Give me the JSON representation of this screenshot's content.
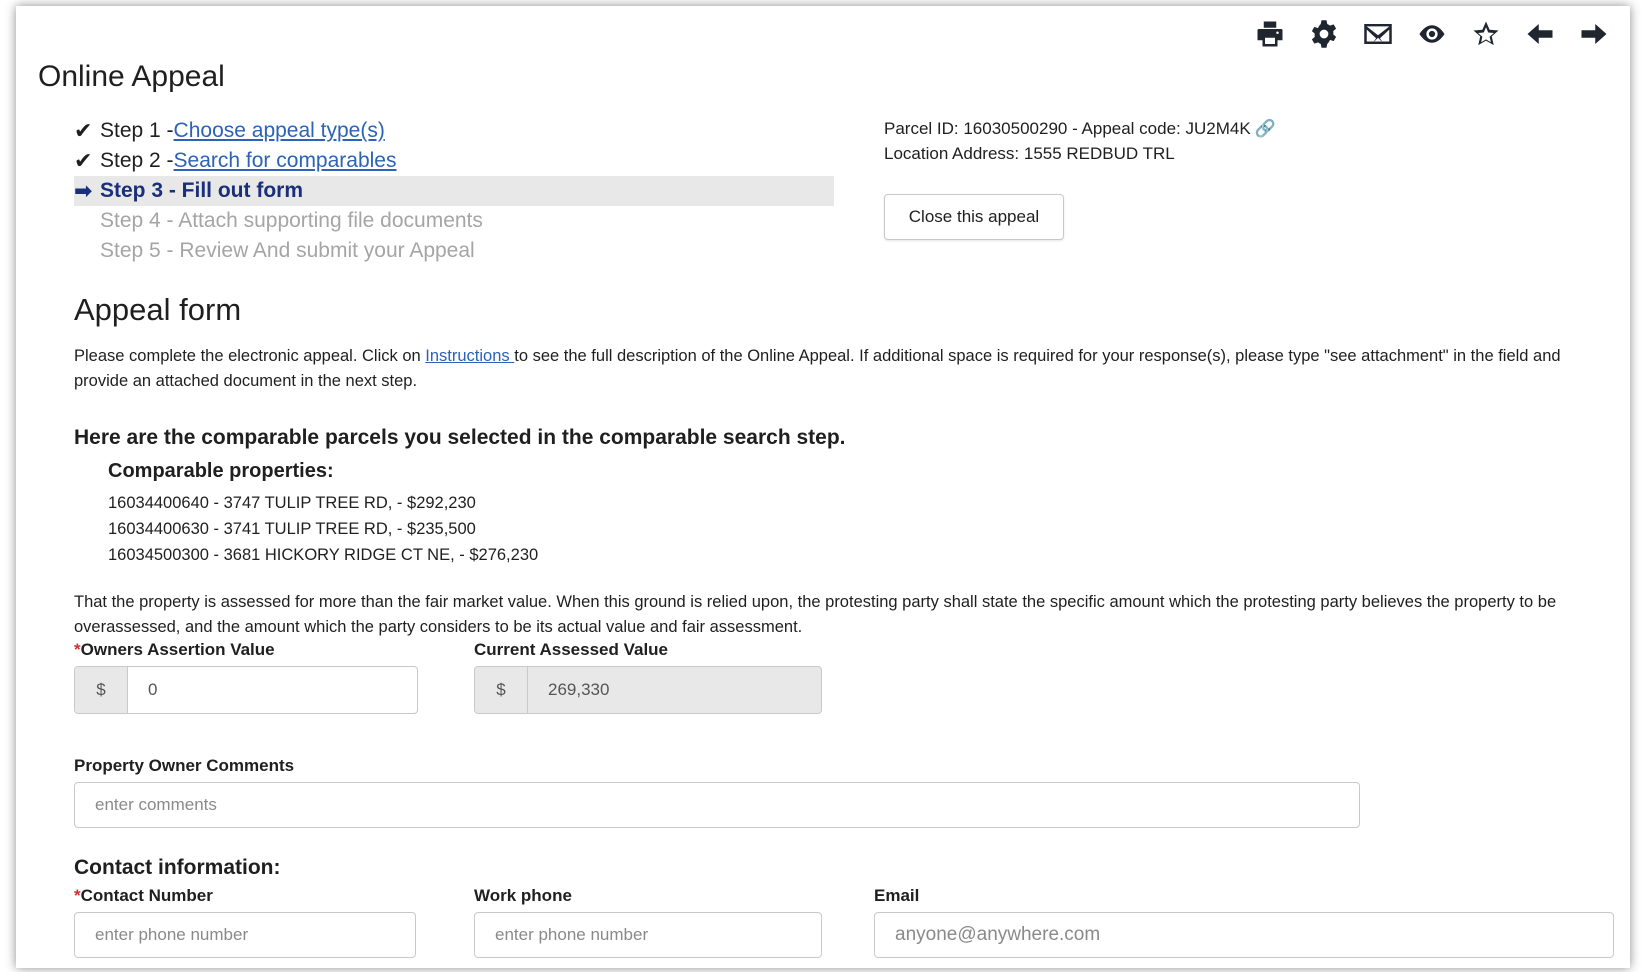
{
  "toolbar": {
    "icons": [
      "print-icon",
      "gear-icon",
      "mail-icon",
      "eye-icon",
      "star-icon",
      "arrow-left-icon",
      "arrow-right-icon"
    ]
  },
  "page": {
    "title": "Online Appeal"
  },
  "steps": [
    {
      "prefix": "Step 1 - ",
      "link": "Choose appeal type(s)",
      "status": "done"
    },
    {
      "prefix": "Step 2 - ",
      "link": "Search for comparables",
      "status": "done"
    },
    {
      "label": "Step 3 - Fill out form",
      "status": "current"
    },
    {
      "label": "Step 4 - Attach supporting file documents",
      "status": "pending"
    },
    {
      "label": "Step 5 - Review And submit your Appeal",
      "status": "pending"
    }
  ],
  "parcel": {
    "line1": "Parcel ID: 16030500290 - Appeal code: JU2M4K",
    "line2": "Location Address: 1555 REDBUD TRL",
    "close_button": "Close this appeal"
  },
  "form": {
    "title": "Appeal form",
    "instructions_before": "Please complete the electronic appeal. Click on ",
    "instructions_link": "Instructions ",
    "instructions_after": "to see the full description of the Online Appeal. If additional space is required for your response(s), please type \"see attachment\" in the field and provide an attached document in the next step.",
    "comparables_heading": "Here are the comparable parcels you selected in the comparable search step.",
    "comparables_subheading": "Comparable properties:",
    "comparables": [
      "16034400640 - 3747 TULIP TREE RD, - $292,230",
      "16034400630 - 3741 TULIP TREE RD, - $235,500",
      "16034500300 - 3681 HICKORY RIDGE CT NE, - $276,230"
    ],
    "ground_text": "That the property is assessed for more than the fair market value. When this ground is relied upon, the protesting party shall state the specific amount which the protesting party believes the property to be overassessed, and the amount which the party considers to be its actual value and fair assessment.",
    "owners_assertion": {
      "label": "Owners Assertion Value",
      "required_mark": "*",
      "currency": "$",
      "value": "0"
    },
    "current_assessed": {
      "label": "Current Assessed Value",
      "currency": "$",
      "value": "269,330"
    },
    "comments": {
      "label": "Property Owner Comments",
      "placeholder": "enter comments"
    },
    "contact": {
      "heading": "Contact information:",
      "contact_number": {
        "label": "Contact Number",
        "required_mark": "*",
        "placeholder": "enter phone number"
      },
      "work_phone": {
        "label": "Work phone",
        "placeholder": "enter phone number"
      },
      "email": {
        "label": "Email",
        "placeholder": "anyone@anywhere.com"
      }
    }
  }
}
